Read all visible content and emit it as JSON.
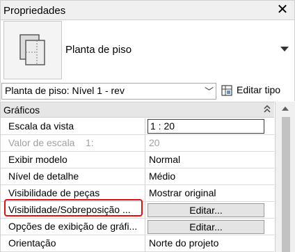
{
  "panel": {
    "title": "Propriedades",
    "close_icon": "close-icon"
  },
  "type_selector": {
    "icon": "floor-plan-icon",
    "type_name": "Planta de piso"
  },
  "instance_selector": {
    "value": "Planta de piso: Nível 1 - rev",
    "edit_type_label": "Editar tipo",
    "edit_type_icon": "edit-type-icon"
  },
  "grid": {
    "group_label": "Gráficos",
    "rows": [
      {
        "name": "Escala da vista",
        "value": "1 : 20"
      },
      {
        "name": "Valor de escala    1:",
        "value": "20"
      },
      {
        "name": "Exibir modelo",
        "value": "Normal"
      },
      {
        "name": "Nível de detalhe",
        "value": "Médio"
      },
      {
        "name": "Visibilidade de peças",
        "value": "Mostrar original"
      },
      {
        "name": "Visibilidade/Sobreposição ...",
        "value": "Editar..."
      },
      {
        "name": "Opções de exibição de gráfi...",
        "value": "Editar..."
      },
      {
        "name": "Orientação",
        "value": "Norte do projeto"
      }
    ]
  },
  "colors": {
    "highlight": "#e01010",
    "group_background": "#e6e6e6",
    "disabled_text": "#a0a0a0"
  }
}
